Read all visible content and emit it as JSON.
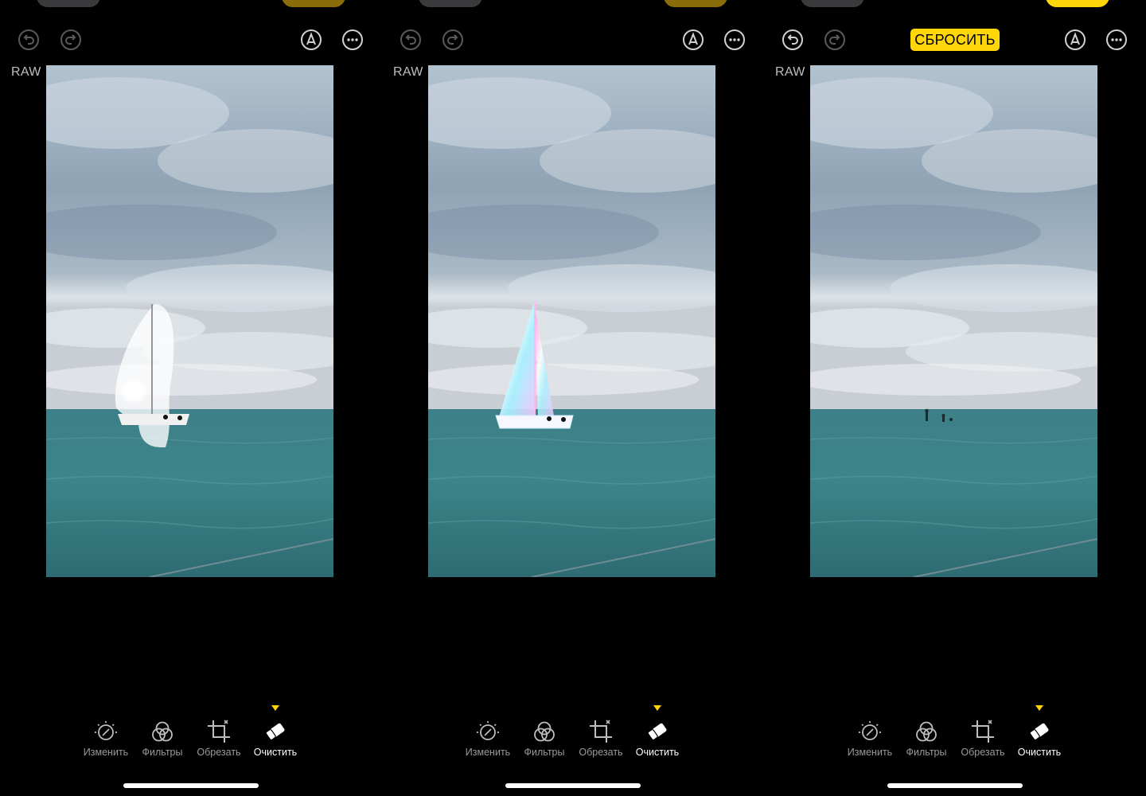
{
  "panels": [
    {
      "raw_label": "RAW",
      "reset_label": "",
      "stage": "selection"
    },
    {
      "raw_label": "RAW",
      "reset_label": "",
      "stage": "processing"
    },
    {
      "raw_label": "RAW",
      "reset_label": "СБРОСИТЬ",
      "stage": "result"
    }
  ],
  "tools": {
    "adjust": "Изменить",
    "filters": "Фильтры",
    "crop": "Обрезать",
    "cleanup": "Очистить"
  },
  "colors": {
    "accent": "#ffd60a",
    "inactive_label": "#9a9a9a",
    "icon": "#8e8e93"
  },
  "icons": [
    "undo-icon",
    "redo-icon",
    "markup-icon",
    "more-icon",
    "adjust-icon",
    "filters-icon",
    "crop-icon",
    "eraser-icon"
  ]
}
